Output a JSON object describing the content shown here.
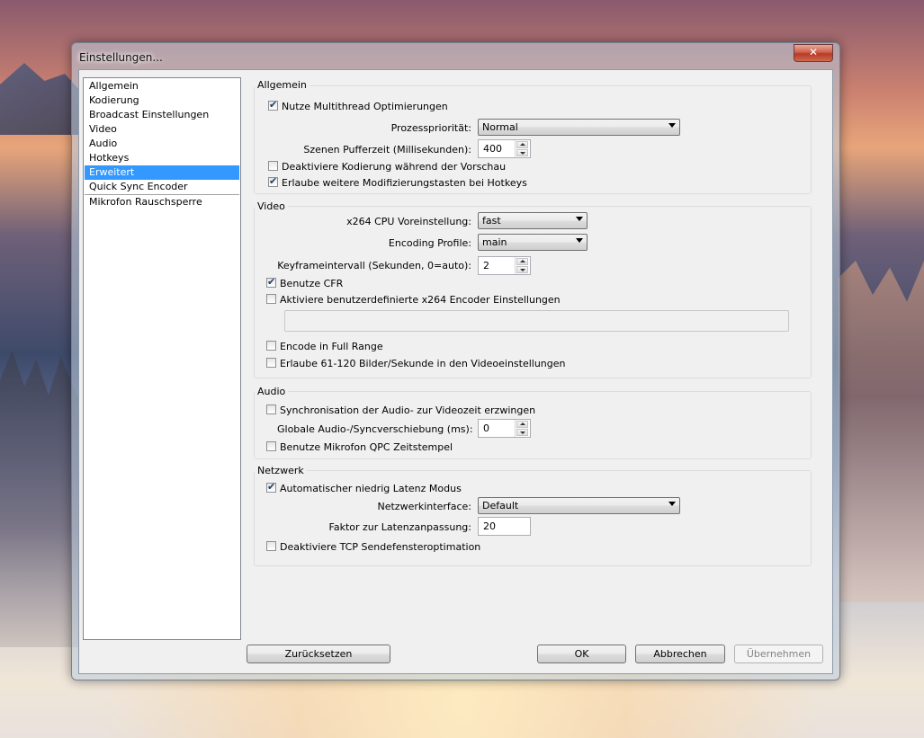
{
  "window": {
    "title": "Einstellungen...",
    "close_glyph": "✕"
  },
  "sidebar": {
    "items": [
      {
        "label": "Allgemein"
      },
      {
        "label": "Kodierung"
      },
      {
        "label": "Broadcast Einstellungen"
      },
      {
        "label": "Video"
      },
      {
        "label": "Audio"
      },
      {
        "label": "Hotkeys"
      },
      {
        "label": "Erweitert",
        "selected": true
      },
      {
        "label": "Quick Sync Encoder"
      },
      {
        "label": "Mikrofon Rauschsperre"
      }
    ]
  },
  "general": {
    "title": "Allgemein",
    "multithread_label": "Nutze Multithread Optimierungen",
    "multithread_checked": true,
    "priority_label": "Prozesspriorität:",
    "priority_value": "Normal",
    "buffer_label": "Szenen Pufferzeit (Millisekunden):",
    "buffer_value": "400",
    "disable_preview_label": "Deaktiviere Kodierung während der Vorschau",
    "disable_preview_checked": false,
    "modifier_keys_label": "Erlaube weitere Modifizierungstasten bei Hotkeys",
    "modifier_keys_checked": true
  },
  "video": {
    "title": "Video",
    "preset_label": "x264 CPU Voreinstellung:",
    "preset_value": "fast",
    "profile_label": "Encoding Profile:",
    "profile_value": "main",
    "keyframe_label": "Keyframeintervall (Sekunden, 0=auto):",
    "keyframe_value": "2",
    "cfr_label": "Benutze CFR",
    "cfr_checked": true,
    "custom_x264_label": "Aktiviere benutzerdefinierte x264 Encoder Einstellungen",
    "custom_x264_checked": false,
    "custom_x264_value": "",
    "full_range_label": "Encode in Full Range",
    "full_range_checked": false,
    "high_fps_label": "Erlaube 61-120 Bilder/Sekunde in den Videoeinstellungen",
    "high_fps_checked": false
  },
  "audio": {
    "title": "Audio",
    "sync_label": "Synchronisation der Audio- zur Videozeit erzwingen",
    "sync_checked": false,
    "offset_label": "Globale Audio-/Syncverschiebung (ms):",
    "offset_value": "0",
    "mic_qpc_label": "Benutze Mikrofon QPC Zeitstempel",
    "mic_qpc_checked": false
  },
  "network": {
    "title": "Netzwerk",
    "low_latency_label": "Automatischer niedrig Latenz Modus",
    "low_latency_checked": true,
    "interface_label": "Netzwerkinterface:",
    "interface_value": "Default",
    "latency_factor_label": "Faktor zur Latenzanpassung:",
    "latency_factor_value": "20",
    "tcp_opt_label": "Deaktiviere TCP Sendefensteroptimation",
    "tcp_opt_checked": false
  },
  "buttons": {
    "reset": "Zurücksetzen",
    "ok": "OK",
    "cancel": "Abbrechen",
    "apply": "Übernehmen"
  },
  "icons": {
    "checkmark": "✔"
  }
}
